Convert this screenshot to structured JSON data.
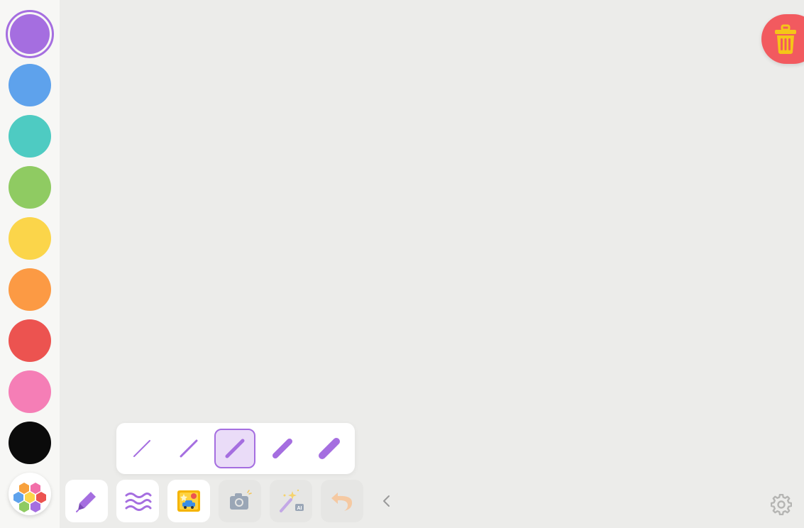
{
  "palette": {
    "colors": [
      {
        "name": "purple",
        "hex": "#a56ee0",
        "selected": true
      },
      {
        "name": "blue",
        "hex": "#5ea2ec"
      },
      {
        "name": "teal",
        "hex": "#4ecbc2"
      },
      {
        "name": "green",
        "hex": "#8fcb62"
      },
      {
        "name": "yellow",
        "hex": "#fbd54a"
      },
      {
        "name": "orange",
        "hex": "#fc9a44"
      },
      {
        "name": "red",
        "hex": "#ec5350"
      },
      {
        "name": "pink",
        "hex": "#f57eb6"
      },
      {
        "name": "black",
        "hex": "#0b0b0b"
      }
    ],
    "custom_icon": "hexagon-palette-icon"
  },
  "brush_sizes": {
    "options": [
      "thinnest",
      "thin",
      "medium",
      "thick",
      "thickest"
    ],
    "selected_index": 2,
    "stroke_color": "#a56ee0"
  },
  "toolbar": {
    "tools": [
      {
        "name": "pen-tool",
        "icon": "pen-icon",
        "enabled": true
      },
      {
        "name": "pattern-brush-tool",
        "icon": "wavy-lines-icon",
        "enabled": true
      },
      {
        "name": "sticker-tool",
        "icon": "sticker-picture-icon",
        "enabled": true
      },
      {
        "name": "camera-tool",
        "icon": "camera-icon",
        "enabled": false
      },
      {
        "name": "ai-magic-tool",
        "icon": "magic-wand-ai-icon",
        "enabled": false,
        "badge": "AI"
      },
      {
        "name": "undo-tool",
        "icon": "undo-icon",
        "enabled": false
      }
    ],
    "collapse_icon": "chevron-left-icon",
    "settings_icon": "gear-icon"
  },
  "trash": {
    "icon": "trash-icon",
    "color": "#f25a5f"
  },
  "accent_color": "#a56ee0"
}
